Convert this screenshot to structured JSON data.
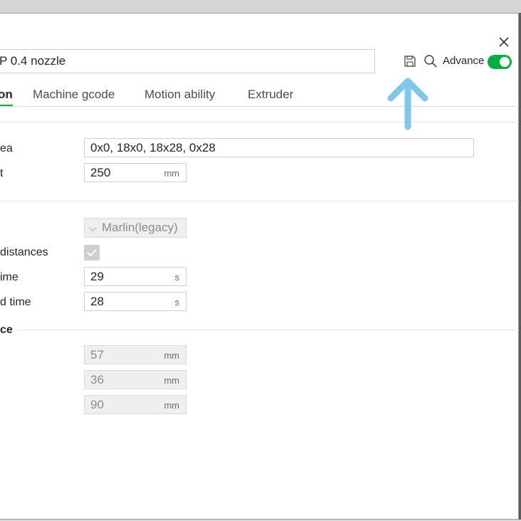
{
  "preset_name": "P 0.4 nozzle",
  "toolbar": {
    "advance_label": "Advance",
    "advance_on": true
  },
  "tabs": [
    {
      "label": "on",
      "active": true
    },
    {
      "label": "Machine gcode",
      "active": false
    },
    {
      "label": "Motion ability",
      "active": false
    },
    {
      "label": "Extruder",
      "active": false
    }
  ],
  "fields": {
    "printable_area": {
      "label": "ea",
      "value": "0x0, 18x0, 18x28, 0x28"
    },
    "height": {
      "label": "t",
      "value": "250",
      "unit": "mm"
    },
    "gcode_flavor": {
      "value": "Marlin(legacy)"
    },
    "distances": {
      "label": "distances",
      "checked": true
    },
    "time": {
      "label": "ime",
      "value": "29",
      "unit": "s"
    },
    "load_time": {
      "label": "d time",
      "value": "28",
      "unit": "s"
    }
  },
  "section": {
    "title": "ce",
    "values": [
      {
        "value": "57",
        "unit": "mm"
      },
      {
        "value": "36",
        "unit": "mm"
      },
      {
        "value": "90",
        "unit": "mm"
      }
    ]
  },
  "colors": {
    "accent": "#00ae42",
    "annotation_arrow": "#7fc8ec"
  },
  "icons": [
    "close-icon",
    "save-icon",
    "search-icon",
    "checkmark-icon",
    "chevron-down-icon"
  ]
}
